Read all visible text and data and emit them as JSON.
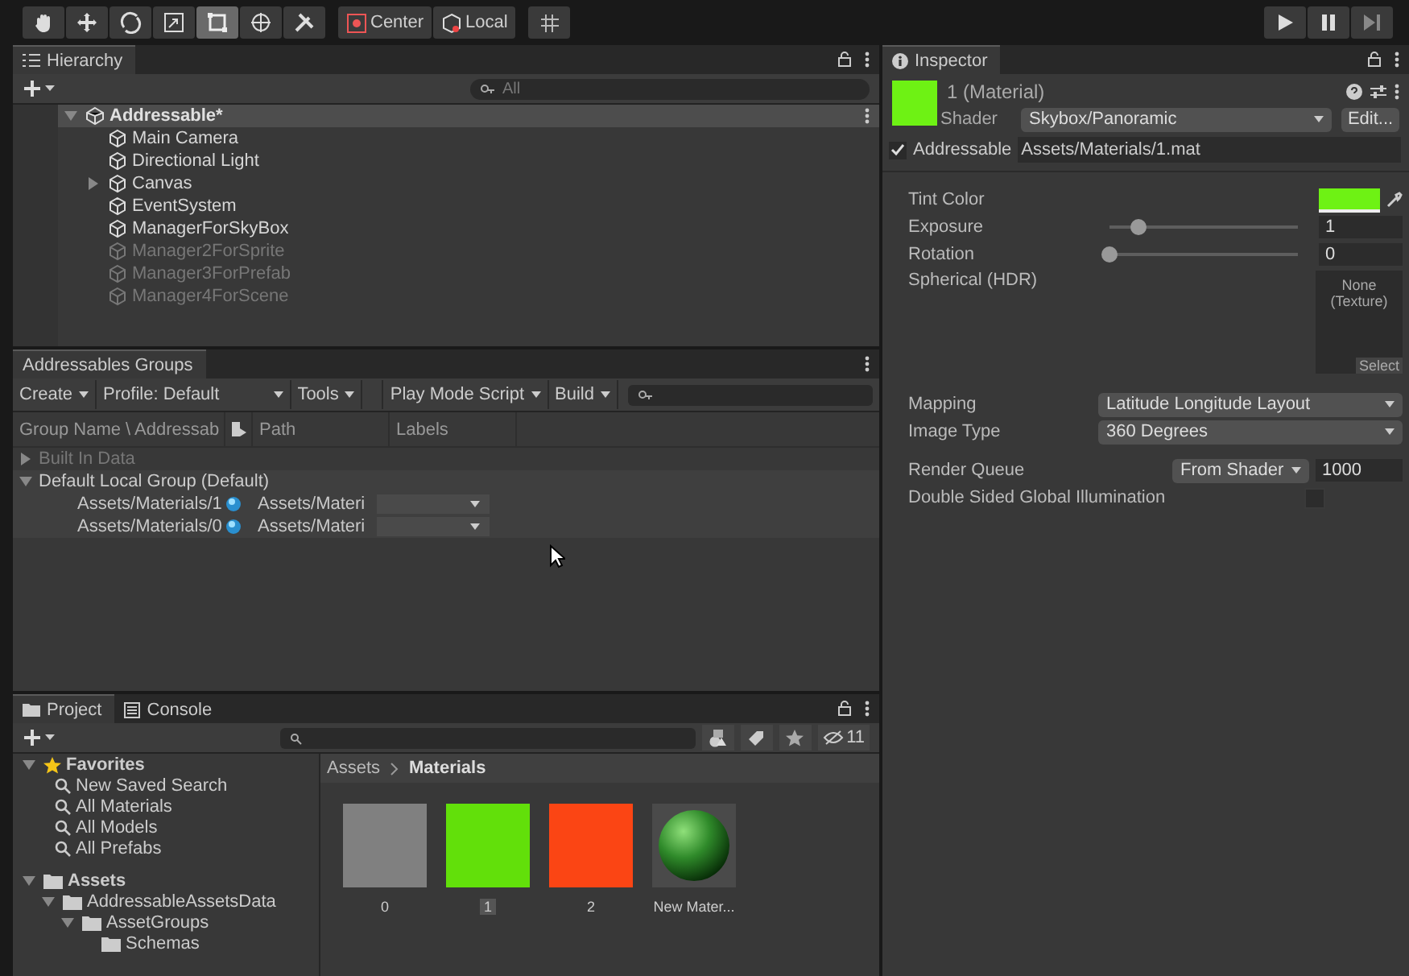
{
  "toolbar": {
    "tools": [
      {
        "kind": "hand",
        "selected": false
      },
      {
        "kind": "move",
        "selected": false
      },
      {
        "kind": "rotate",
        "selected": false
      },
      {
        "kind": "scale",
        "selected": false
      },
      {
        "kind": "rect",
        "selected": true
      },
      {
        "kind": "transform",
        "selected": false
      },
      {
        "kind": "custom",
        "selected": false
      }
    ],
    "pivot": [
      {
        "kind": "center",
        "label": "Center"
      },
      {
        "kind": "local",
        "label": "Local"
      }
    ],
    "play": [
      {
        "kind": "play"
      },
      {
        "kind": "pause"
      },
      {
        "kind": "step"
      }
    ]
  },
  "hierarchy": {
    "tab": "Hierarchy",
    "search_placeholder": "All",
    "scene": {
      "name": "Addressable*",
      "expanded": true
    },
    "items": [
      {
        "name": "Main Camera",
        "expandable": false,
        "disabled": false
      },
      {
        "name": "Directional Light",
        "expandable": false,
        "disabled": false
      },
      {
        "name": "Canvas",
        "expandable": true,
        "disabled": false
      },
      {
        "name": "EventSystem",
        "expandable": false,
        "disabled": false
      },
      {
        "name": "ManagerForSkyBox",
        "expandable": false,
        "disabled": false
      },
      {
        "name": "Manager2ForSprite",
        "expandable": false,
        "disabled": true
      },
      {
        "name": "Manager3ForPrefab",
        "expandable": false,
        "disabled": true
      },
      {
        "name": "Manager4ForScene",
        "expandable": false,
        "disabled": true
      }
    ]
  },
  "groups": {
    "tab": "Addressables Groups",
    "menus": [
      "Create",
      "Profile: Default",
      "Tools",
      "Play Mode Script",
      "Build"
    ],
    "columns": [
      "Group Name \\ Addressab",
      "Path",
      "Labels"
    ],
    "rows": [
      {
        "name": "Built In Data",
        "expanded": false,
        "disabled": true,
        "entries": []
      },
      {
        "name": "Default Local Group (Default)",
        "expanded": true,
        "disabled": false,
        "entries": [
          {
            "address": "Assets/Materials/1",
            "path": "Assets/Materi"
          },
          {
            "address": "Assets/Materials/0",
            "path": "Assets/Materi"
          }
        ]
      }
    ]
  },
  "project": {
    "tabs": [
      {
        "label": "Project",
        "selected": true
      },
      {
        "label": "Console",
        "selected": false
      }
    ],
    "hidden_count": "11",
    "favorites": {
      "label": "Favorites",
      "items": [
        "New Saved Search",
        "All Materials",
        "All Models",
        "All Prefabs"
      ]
    },
    "tree": [
      {
        "name": "Assets",
        "children": [
          {
            "name": "AddressableAssetsData",
            "children": [
              {
                "name": "AssetGroups",
                "children": [
                  {
                    "name": "Schemas"
                  }
                ]
              }
            ]
          }
        ]
      }
    ],
    "breadcrumb": [
      "Assets",
      "Materials"
    ],
    "assets": [
      {
        "name": "0",
        "kind": "swatch",
        "color": "#808080",
        "selected": false
      },
      {
        "name": "1",
        "kind": "swatch",
        "color": "#62e00a",
        "selected": true
      },
      {
        "name": "2",
        "kind": "swatch",
        "color": "#fb4514",
        "selected": false
      },
      {
        "name": "New Mater...",
        "kind": "sphere",
        "color": "#2f8a2a",
        "selected": false
      }
    ]
  },
  "inspector": {
    "tab": "Inspector",
    "title": "1 (Material)",
    "shader_label": "Shader",
    "shader": "Skybox/Panoramic",
    "edit": "Edit...",
    "addressable": {
      "checked": true,
      "label": "Addressable",
      "path": "Assets/Materials/1.mat"
    },
    "properties": [
      {
        "kind": "color",
        "label": "Tint Color",
        "color": "#6ef214"
      },
      {
        "kind": "slider",
        "label": "Exposure",
        "level": 0.14,
        "value": "1"
      },
      {
        "kind": "slider",
        "label": "Rotation",
        "level": 0,
        "value": "0"
      },
      {
        "kind": "texture",
        "label": "Spherical  (HDR)",
        "value": "None\n(Texture)",
        "button": "Select"
      },
      {
        "kind": "gap"
      },
      {
        "kind": "dropdown",
        "label": "Mapping",
        "value": "Latitude Longitude Layout"
      },
      {
        "kind": "dropdown",
        "label": "Image Type",
        "value": "360 Degrees"
      },
      {
        "kind": "gap"
      },
      {
        "kind": "queue",
        "label": "Render Queue",
        "value": "From Shader",
        "number": "1000"
      },
      {
        "kind": "checkbox",
        "label": "Double Sided Global Illumination",
        "checked": false
      }
    ]
  }
}
